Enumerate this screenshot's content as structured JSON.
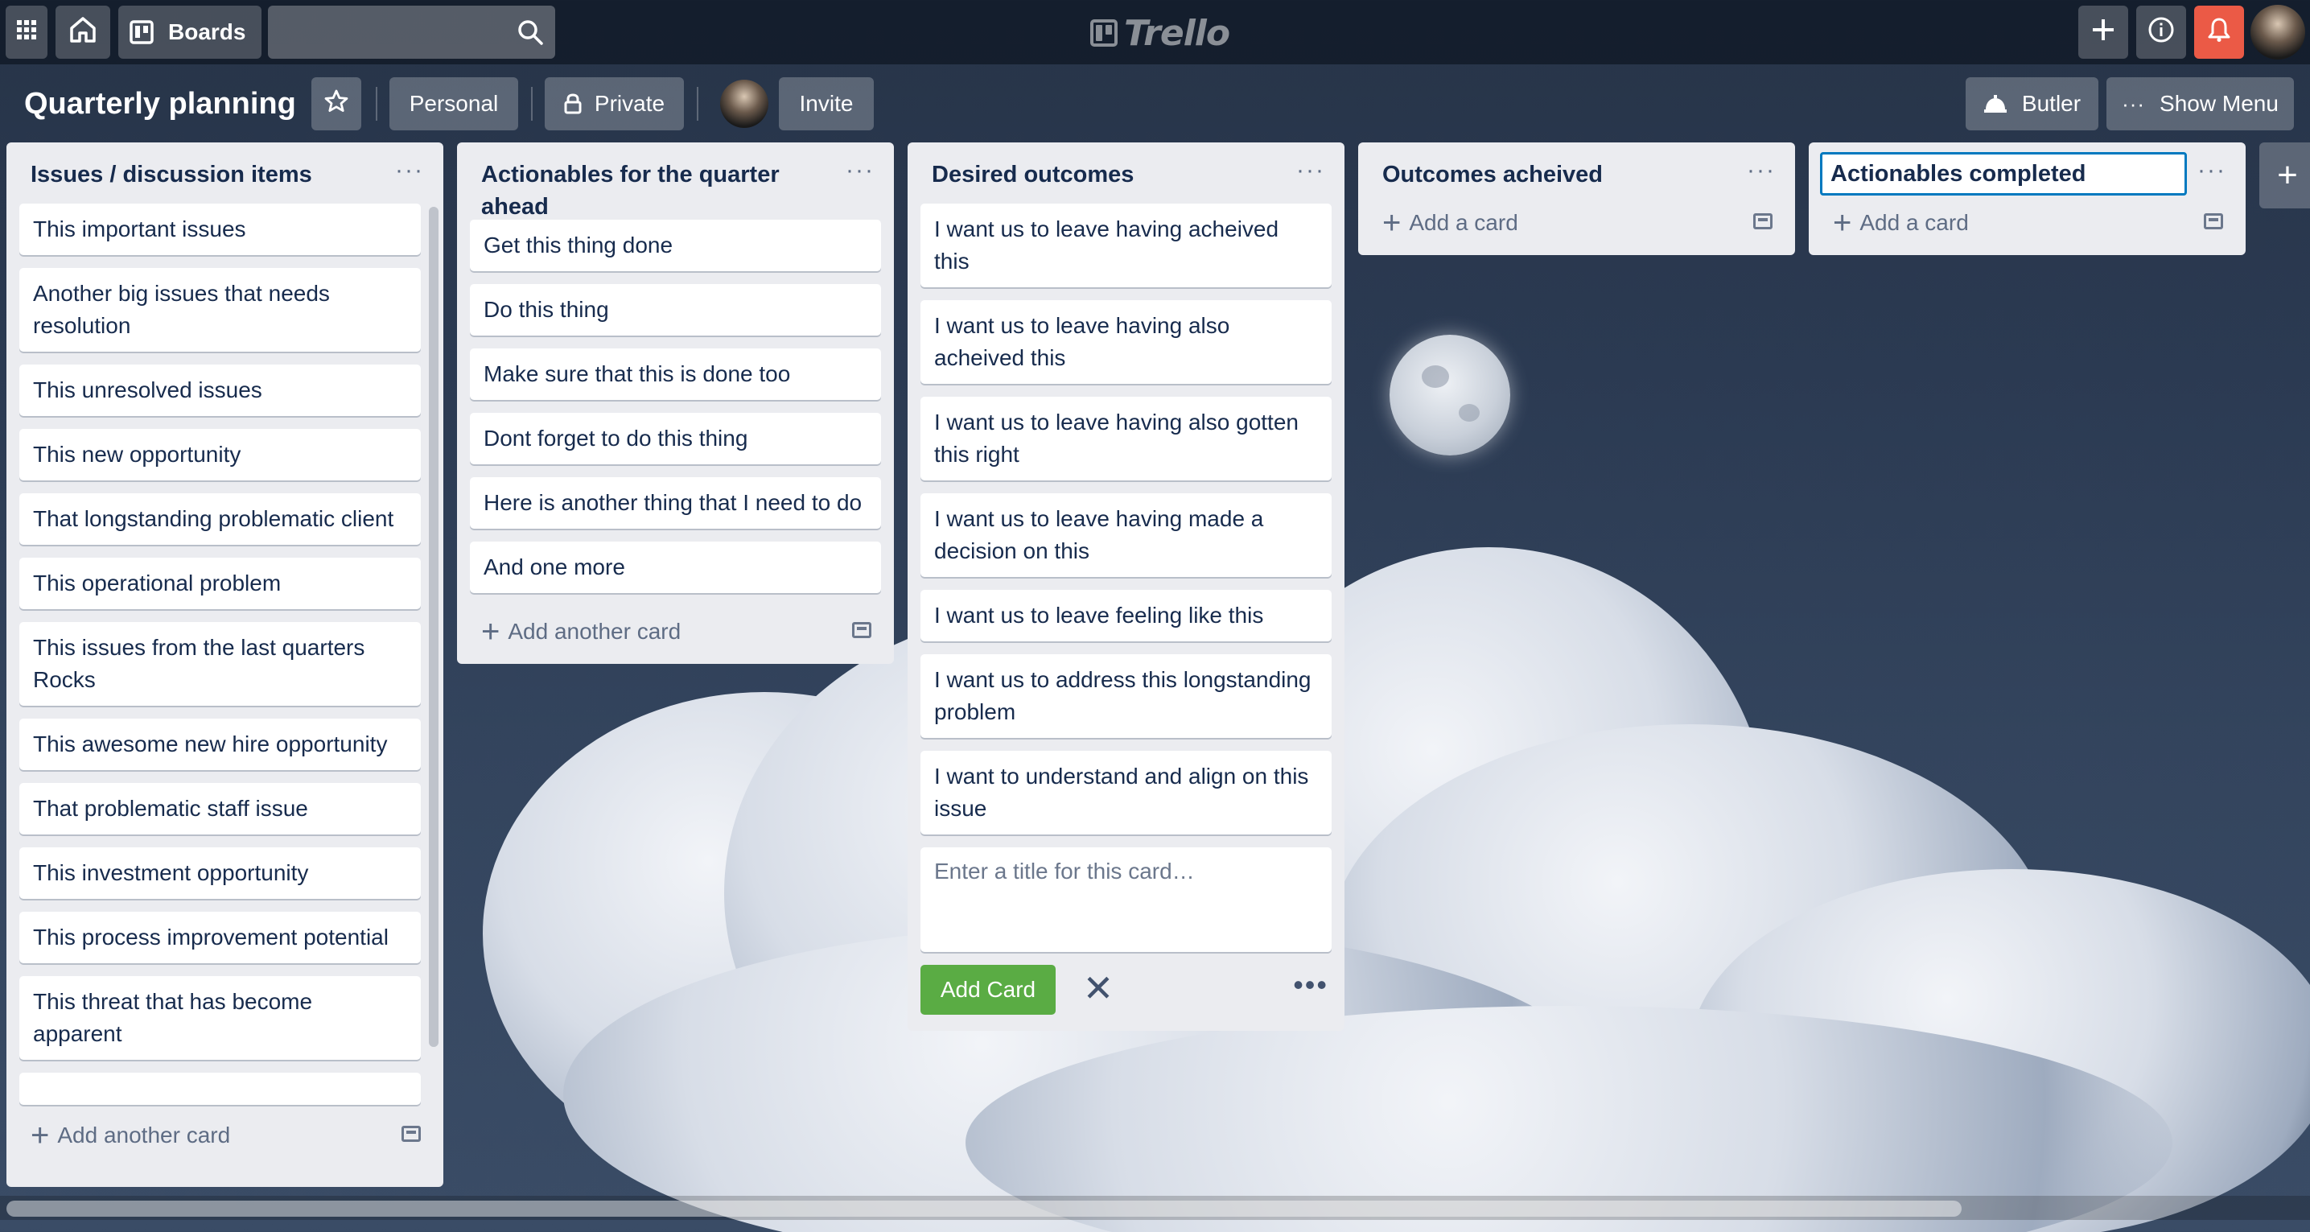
{
  "topbar": {
    "boards_label": "Boards",
    "search_value": "",
    "logo_text": "Trello",
    "notification_color": "#eb5a46"
  },
  "board": {
    "title": "Quarterly planning",
    "visibility_team": "Personal",
    "visibility_privacy": "Private",
    "invite_label": "Invite",
    "butler_label": "Butler",
    "show_menu_label": "Show Menu"
  },
  "lists": [
    {
      "title": "Issues / discussion items",
      "cards": [
        "This important issues",
        "Another big issues that needs resolution",
        "This unresolved issues",
        "This new opportunity",
        "That longstanding problematic client",
        "This operational problem",
        "This issues from the last quarters Rocks",
        "This awesome new hire opportunity",
        "That problematic staff issue",
        "This investment opportunity",
        "This process improvement potential",
        "This threat that has become apparent"
      ],
      "add_label": "Add another card"
    },
    {
      "title": "Actionables for the quarter ahead",
      "cards": [
        "Get this thing done",
        "Do this thing",
        "Make sure that this is done too",
        "Dont forget to do this thing",
        "Here is another thing that I need to do",
        "And one more"
      ],
      "add_label": "Add another card"
    },
    {
      "title": "Desired outcomes",
      "cards": [
        "I want us to leave having acheived this",
        "I want us to leave having also acheived this",
        "I want us to leave having also gotten this right",
        "I want us to leave having made a decision on this",
        "I want us to leave feeling like this",
        "I want us to address this longstanding problem",
        "I want to understand and align on this issue"
      ],
      "composer_placeholder": "Enter a title for this card…",
      "composer_button": "Add Card"
    },
    {
      "title": "Outcomes acheived",
      "cards": [],
      "add_label": "Add a card"
    },
    {
      "title": "Actionables completed",
      "cards": [],
      "add_label": "Add a card"
    }
  ]
}
